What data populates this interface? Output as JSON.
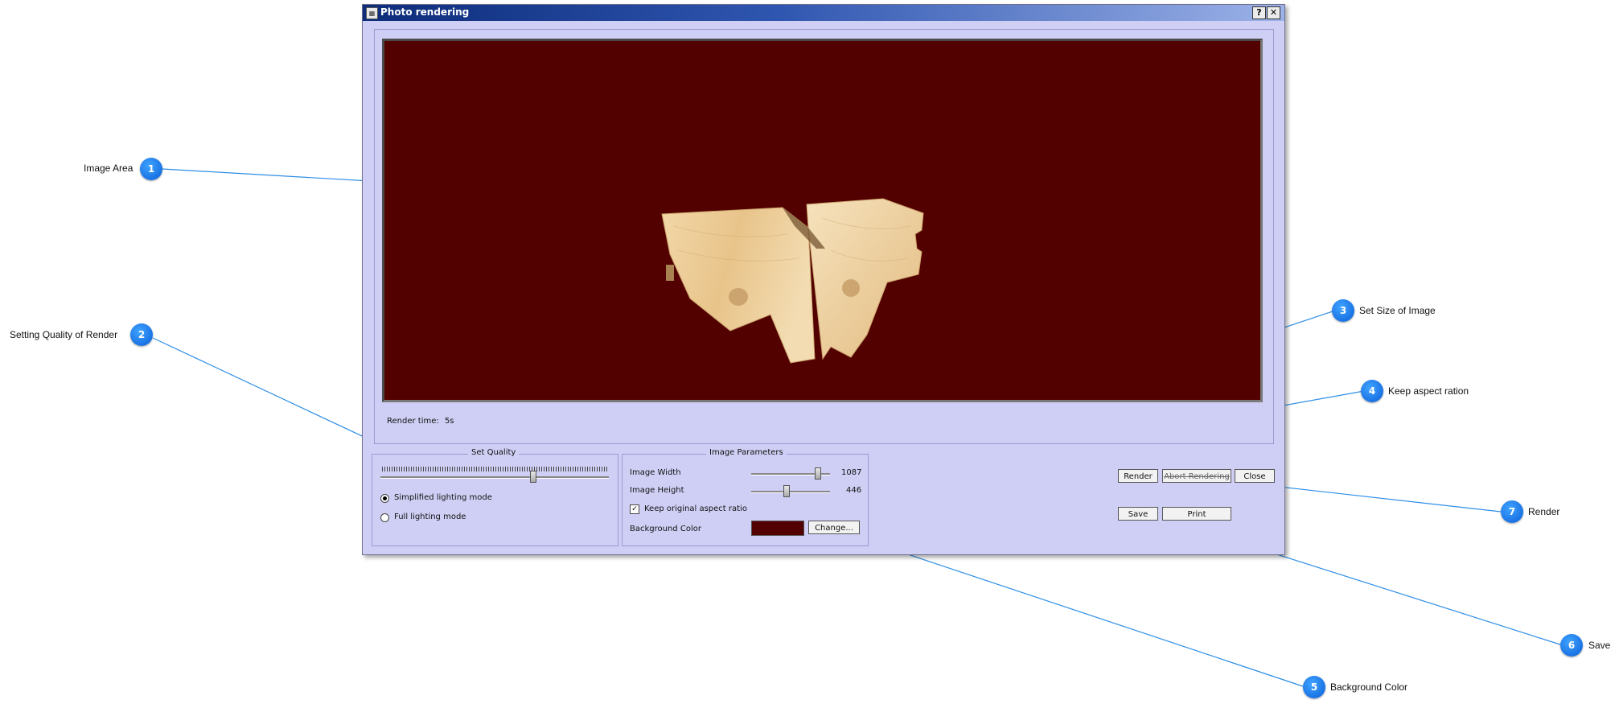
{
  "window": {
    "title": "Photo rendering",
    "help_label": "?",
    "close_label": "✕",
    "app_icon": "photo-render-app-icon"
  },
  "render": {
    "background_color": "#530000",
    "render_time_label": "Render time:",
    "render_time_value": "5s",
    "object": "wooden-joint-model"
  },
  "quality": {
    "title": "Set Quality",
    "slider_level_percent": 69,
    "lighting_options": [
      {
        "label": "Simplified lighting mode",
        "selected": true
      },
      {
        "label": "Full lighting mode",
        "selected": false
      }
    ]
  },
  "image_params": {
    "title": "Image Parameters",
    "width_label": "Image Width",
    "width_value": "1087",
    "height_label": "Image Height",
    "height_value": "446",
    "keep_aspect_label": "Keep original aspect ratio",
    "keep_aspect_checked": true,
    "bg_color_label": "Background Color",
    "bg_color": "#530000",
    "change_label": "Change..."
  },
  "buttons": {
    "render": "Render",
    "abort": "Abort Rendering",
    "close": "Close",
    "save": "Save",
    "print": "Print"
  },
  "callouts": [
    {
      "n": "1",
      "label": "Image Area"
    },
    {
      "n": "2",
      "label": "Setting Quality of Render"
    },
    {
      "n": "3",
      "label": "Set Size of Image"
    },
    {
      "n": "4",
      "label": "Keep aspect ration"
    },
    {
      "n": "5",
      "label": "Background Color"
    },
    {
      "n": "6",
      "label": "Save"
    },
    {
      "n": "7",
      "label": "Render"
    }
  ],
  "colors": {
    "callout_blue": "#0a6be0",
    "dialog_bg": "#cfcff5",
    "titlebar": "#0d2c7a"
  }
}
